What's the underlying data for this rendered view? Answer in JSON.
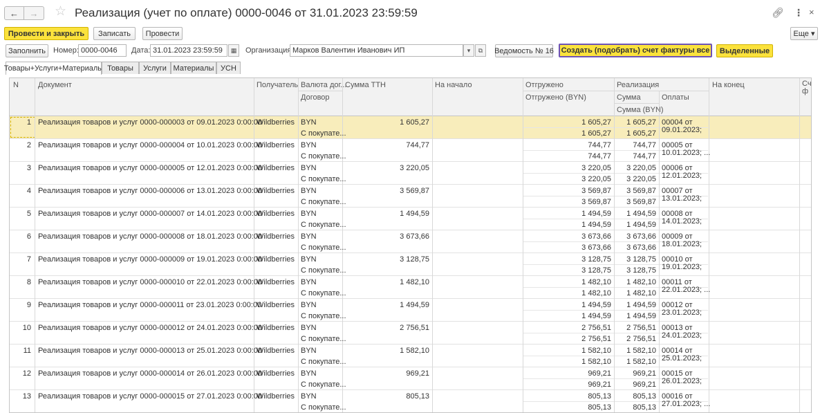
{
  "window": {
    "title": "Реализация (учет по оплате) 0000-0046 от 31.01.2023 23:59:59"
  },
  "toolbar": {
    "post_close": "Провести и закрыть",
    "save": "Записать",
    "post": "Провести",
    "more": "Еще ▾"
  },
  "form": {
    "fill": "Заполнить",
    "number_label": "Номер:",
    "number_value": "0000-0046",
    "date_label": "Дата:",
    "date_value": "31.01.2023 23:59:59",
    "org_label": "Организация:",
    "org_value": "Марков Валентин Иванович ИП",
    "statement": "Ведомость № 16",
    "create_invoice": "Создать (подобрать) счет фактуры все",
    "selected": "Выделенные"
  },
  "tabs": [
    "Товары+Услуги+Материалы",
    "Товары",
    "Услуги",
    "Материалы",
    "УСН"
  ],
  "columns": {
    "n": "N",
    "document": "Документ",
    "recipient": "Получатель",
    "currency": "Валюта дог...",
    "contract": "Договор",
    "sum_ttn": "Сумма ТТН",
    "start": "На начало",
    "shipped": "Отгружено",
    "shipped_byn": "Отгружено (BYN)",
    "realization": "Реализация",
    "sum": "Сумма",
    "sum_byn": "Сумма (BYN)",
    "payments": "Оплаты",
    "end": "На конец",
    "last": "Сч\nф"
  },
  "rows": [
    {
      "n": "1",
      "doc": "Реализация товаров и услуг 0000-000003 от 09.01.2023 0:00:00",
      "recipient": "Wildberries",
      "currency": "BYN",
      "contract": "С покупате...",
      "sum_ttn": "1 605,27",
      "shipped": "1 605,27",
      "shipped_byn": "1 605,27",
      "sum": "1 605,27",
      "sum_byn": "1 605,27",
      "pay1": "00004 от",
      "pay2": "09.01.2023;"
    },
    {
      "n": "2",
      "doc": "Реализация товаров и услуг 0000-000004 от 10.01.2023 0:00:00",
      "recipient": "Wildberries",
      "currency": "BYN",
      "contract": "С покупате...",
      "sum_ttn": "744,77",
      "shipped": "744,77",
      "shipped_byn": "744,77",
      "sum": "744,77",
      "sum_byn": "744,77",
      "pay1": "00005 от",
      "pay2": "10.01.2023; ..."
    },
    {
      "n": "3",
      "doc": "Реализация товаров и услуг 0000-000005 от 12.01.2023 0:00:00",
      "recipient": "Wildberries",
      "currency": "BYN",
      "contract": "С покупате...",
      "sum_ttn": "3 220,05",
      "shipped": "3 220,05",
      "shipped_byn": "3 220,05",
      "sum": "3 220,05",
      "sum_byn": "3 220,05",
      "pay1": "00006 от",
      "pay2": "12.01.2023;"
    },
    {
      "n": "4",
      "doc": "Реализация товаров и услуг 0000-000006 от 13.01.2023 0:00:00",
      "recipient": "Wildberries",
      "currency": "BYN",
      "contract": "С покупате...",
      "sum_ttn": "3 569,87",
      "shipped": "3 569,87",
      "shipped_byn": "3 569,87",
      "sum": "3 569,87",
      "sum_byn": "3 569,87",
      "pay1": "00007 от",
      "pay2": "13.01.2023;"
    },
    {
      "n": "5",
      "doc": "Реализация товаров и услуг 0000-000007 от 14.01.2023 0:00:00",
      "recipient": "Wildberries",
      "currency": "BYN",
      "contract": "С покупате...",
      "sum_ttn": "1 494,59",
      "shipped": "1 494,59",
      "shipped_byn": "1 494,59",
      "sum": "1 494,59",
      "sum_byn": "1 494,59",
      "pay1": "00008 от",
      "pay2": "14.01.2023;"
    },
    {
      "n": "6",
      "doc": "Реализация товаров и услуг 0000-000008 от 18.01.2023 0:00:00",
      "recipient": "Wildberries",
      "currency": "BYN",
      "contract": "С покупате...",
      "sum_ttn": "3 673,66",
      "shipped": "3 673,66",
      "shipped_byn": "3 673,66",
      "sum": "3 673,66",
      "sum_byn": "3 673,66",
      "pay1": "00009 от",
      "pay2": "18.01.2023;"
    },
    {
      "n": "7",
      "doc": "Реализация товаров и услуг 0000-000009 от 19.01.2023 0:00:00",
      "recipient": "Wildberries",
      "currency": "BYN",
      "contract": "С покупате...",
      "sum_ttn": "3 128,75",
      "shipped": "3 128,75",
      "shipped_byn": "3 128,75",
      "sum": "3 128,75",
      "sum_byn": "3 128,75",
      "pay1": "00010 от",
      "pay2": "19.01.2023;"
    },
    {
      "n": "8",
      "doc": "Реализация товаров и услуг 0000-000010 от 22.01.2023 0:00:00",
      "recipient": "Wildberries",
      "currency": "BYN",
      "contract": "С покупате...",
      "sum_ttn": "1 482,10",
      "shipped": "1 482,10",
      "shipped_byn": "1 482,10",
      "sum": "1 482,10",
      "sum_byn": "1 482,10",
      "pay1": "00011 от",
      "pay2": "22.01.2023; ..."
    },
    {
      "n": "9",
      "doc": "Реализация товаров и услуг 0000-000011 от 23.01.2023 0:00:00",
      "recipient": "Wildberries",
      "currency": "BYN",
      "contract": "С покупате...",
      "sum_ttn": "1 494,59",
      "shipped": "1 494,59",
      "shipped_byn": "1 494,59",
      "sum": "1 494,59",
      "sum_byn": "1 494,59",
      "pay1": "00012 от",
      "pay2": "23.01.2023;"
    },
    {
      "n": "10",
      "doc": "Реализация товаров и услуг 0000-000012 от 24.01.2023 0:00:00",
      "recipient": "Wildberries",
      "currency": "BYN",
      "contract": "С покупате...",
      "sum_ttn": "2 756,51",
      "shipped": "2 756,51",
      "shipped_byn": "2 756,51",
      "sum": "2 756,51",
      "sum_byn": "2 756,51",
      "pay1": "00013 от",
      "pay2": "24.01.2023;"
    },
    {
      "n": "11",
      "doc": "Реализация товаров и услуг 0000-000013 от 25.01.2023 0:00:00",
      "recipient": "Wildberries",
      "currency": "BYN",
      "contract": "С покупате...",
      "sum_ttn": "1 582,10",
      "shipped": "1 582,10",
      "shipped_byn": "1 582,10",
      "sum": "1 582,10",
      "sum_byn": "1 582,10",
      "pay1": "00014 от",
      "pay2": "25.01.2023;"
    },
    {
      "n": "12",
      "doc": "Реализация товаров и услуг 0000-000014 от 26.01.2023 0:00:00",
      "recipient": "Wildberries",
      "currency": "BYN",
      "contract": "С покупате...",
      "sum_ttn": "969,21",
      "shipped": "969,21",
      "shipped_byn": "969,21",
      "sum": "969,21",
      "sum_byn": "969,21",
      "pay1": "00015 от",
      "pay2": "26.01.2023;"
    },
    {
      "n": "13",
      "doc": "Реализация товаров и услуг 0000-000015 от 27.01.2023 0:00:00",
      "recipient": "Wildberries",
      "currency": "BYN",
      "contract": "С покупате...",
      "sum_ttn": "805,13",
      "shipped": "805,13",
      "shipped_byn": "805,13",
      "sum": "805,13",
      "sum_byn": "805,13",
      "pay1": "00016 от",
      "pay2": "27.01.2023; ..."
    }
  ],
  "selected_row": 0
}
